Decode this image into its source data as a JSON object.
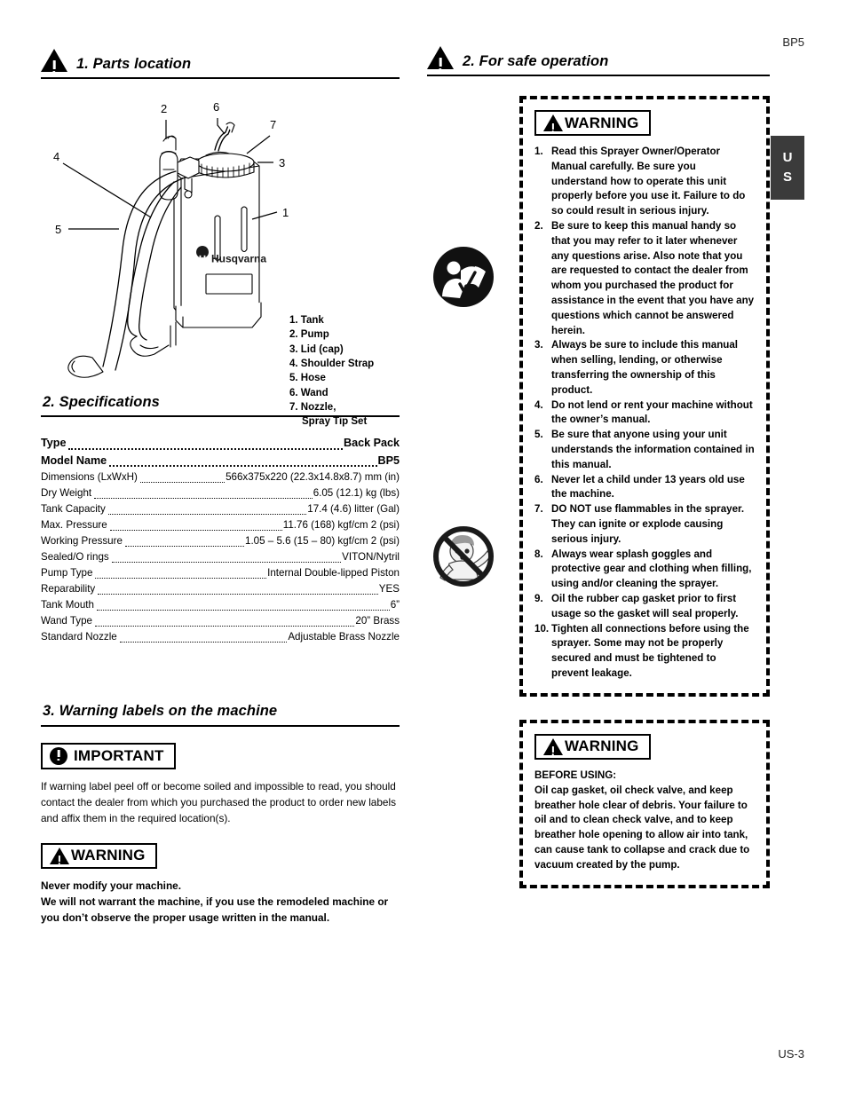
{
  "page": {
    "header_code": "BP5",
    "footer_code": "US-3",
    "lang_tab_line1": "U",
    "lang_tab_line2": "S"
  },
  "sections": {
    "parts_location": {
      "number_title": "1. Parts location",
      "legend": [
        "1. Tank",
        "2. Pump",
        "3. Lid (cap)",
        "4. Shoulder Strap",
        "5. Hose",
        "6. Wand",
        "7. Nozzle,"
      ],
      "legend_continuation": "Spray Tip Set",
      "callouts": [
        "1",
        "2",
        "3",
        "4",
        "5",
        "6",
        "7"
      ],
      "brand_logo_text": "Husqvarna"
    },
    "specifications": {
      "title": "2. Specifications",
      "rows": [
        {
          "key": "Type",
          "value": "Back Pack",
          "bold": true
        },
        {
          "key": "Model Name",
          "value": "BP5",
          "bold": true
        },
        {
          "key": "Dimensions (LxWxH)",
          "value": "566x375x220 (22.3x14.8x8.7) mm (in)",
          "bold": false
        },
        {
          "key": "Dry Weight",
          "value": "6.05 (12.1) kg (lbs)",
          "bold": false
        },
        {
          "key": "Tank Capacity",
          "value": "17.4 (4.6) litter (Gal)",
          "bold": false
        },
        {
          "key": "Max. Pressure",
          "value": "11.76 (168) kgf/cm 2 (psi)",
          "bold": false
        },
        {
          "key": "Working Pressure",
          "value": "1.05 – 5.6 (15 – 80) kgf/cm 2 (psi)",
          "bold": false
        },
        {
          "key": "Sealed/O rings",
          "value": "VITON/Nytril",
          "bold": false
        },
        {
          "key": "Pump Type",
          "value": "Internal Double-lipped Piston",
          "bold": false
        },
        {
          "key": "Reparability",
          "value": "YES",
          "bold": false
        },
        {
          "key": "Tank Mouth",
          "value": "6”",
          "bold": false
        },
        {
          "key": "Wand Type",
          "value": "20” Brass",
          "bold": false
        },
        {
          "key": "Standard Nozzle",
          "value": "Adjustable Brass Nozzle",
          "bold": false
        }
      ]
    },
    "warning_labels": {
      "title": "3. Warning labels on the machine",
      "important_badge": "IMPORTANT",
      "important_text": "If warning label peel off or become soiled and impossible to read, you should contact the dealer from which you purchased the product to order new labels and affix them in the required location(s).",
      "warning_badge": "WARNING",
      "warning_text_line1": "Never modify your machine.",
      "warning_text_line2": "We will not warrant the machine, if you use the remodeled machine or you don’t observe the proper usage written in the manual."
    },
    "safe_operation": {
      "number_title": "2. For safe operation",
      "warning_badge": "WARNING",
      "items": [
        {
          "num": "1.",
          "text": "Read this Sprayer Owner/Operator Manual carefully. Be sure you understand how to operate this unit properly before you use it. Failure to do so could result in serious injury."
        },
        {
          "num": "2.",
          "text": "Be sure to keep this manual handy so that you may refer to it later whenever any questions arise. Also note that you are requested to contact the dealer from whom you purchased the product for assistance in the event that you have any questions which cannot be answered herein."
        },
        {
          "num": "3.",
          "text": "Always be sure to include this manual when selling, lending, or otherwise transferring the ownership of this product."
        },
        {
          "num": "4.",
          "text": "Do not lend or rent your machine without the owner’s manual."
        },
        {
          "num": "5.",
          "text": "Be sure that anyone using your unit understands the information contained in this manual."
        },
        {
          "num": "6.",
          "text": "Never let a child under 13 years old use the machine."
        },
        {
          "num": "7.",
          "text": "DO NOT use flammables in the sprayer. They can ignite or explode causing serious injury."
        },
        {
          "num": "8.",
          "text": "Always wear splash goggles and protective gear and clothing when filling, using and/or cleaning the sprayer."
        },
        {
          "num": "9.",
          "text": "Oil the rubber cap gasket prior to first usage so the gasket will seal properly."
        },
        {
          "num": "10.",
          "text": "Tighten all connections before using the sprayer. Some may not be properly secured and must be tightened to prevent leakage."
        }
      ],
      "second_warning_badge": "WARNING",
      "before_using_header": "BEFORE USING:",
      "before_using_text": "Oil cap gasket, oil check valve, and keep breather hole clear of debris. Your failure to oil and to clean check valve, and to keep breather hole opening to allow air into tank, can cause tank to collapse and crack due to vacuum created by the pump."
    }
  },
  "colors": {
    "ink": "#000000",
    "tab_background": "#3b3b3b",
    "tab_text": "#ffffff"
  }
}
